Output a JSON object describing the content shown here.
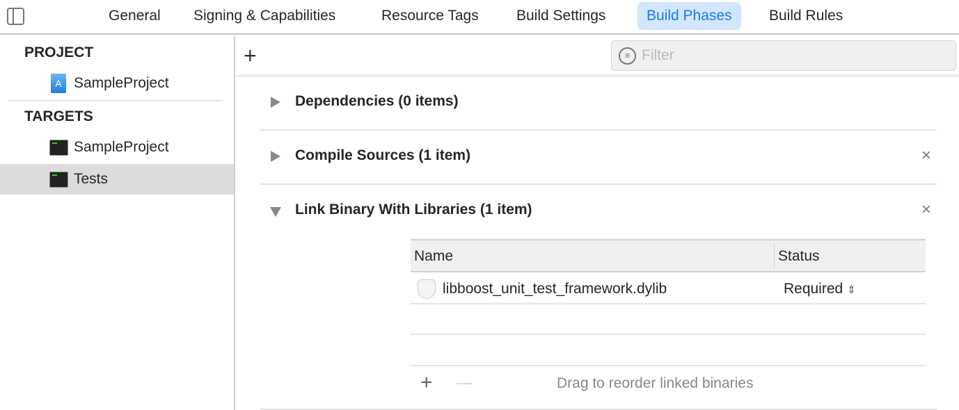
{
  "tabs": [
    {
      "label": "General"
    },
    {
      "label": "Signing & Capabilities"
    },
    {
      "label": "Resource Tags"
    },
    {
      "label": "Build Settings"
    },
    {
      "label": "Build Phases",
      "active": true
    },
    {
      "label": "Build Rules"
    }
  ],
  "sidebar": {
    "project_header": "PROJECT",
    "project_items": [
      {
        "label": "SampleProject",
        "icon": "xcode-project-icon"
      }
    ],
    "targets_header": "TARGETS",
    "target_items": [
      {
        "label": "SampleProject",
        "icon": "terminal-icon"
      },
      {
        "label": "Tests",
        "icon": "terminal-icon",
        "selected": true
      }
    ]
  },
  "toolbar": {
    "add": "+",
    "filter_placeholder": "Filter"
  },
  "phases": [
    {
      "title": "Dependencies (0 items)",
      "expanded": false,
      "removable": false
    },
    {
      "title": "Compile Sources (1 item)",
      "expanded": false,
      "removable": true
    },
    {
      "title": "Link Binary With Libraries (1 item)",
      "expanded": true,
      "removable": true
    }
  ],
  "library_table": {
    "columns": [
      "Name",
      "Status"
    ],
    "rows": [
      {
        "name": "libboost_unit_test_framework.dylib",
        "status": "Required"
      }
    ],
    "footer": "Drag to reorder linked binaries",
    "add": "+",
    "remove": "—",
    "close": "×"
  },
  "colors": {
    "accent": "#1a7cf0",
    "tab_active_bg": "#d3e6fb",
    "selected_row": "#dcdcdc"
  }
}
